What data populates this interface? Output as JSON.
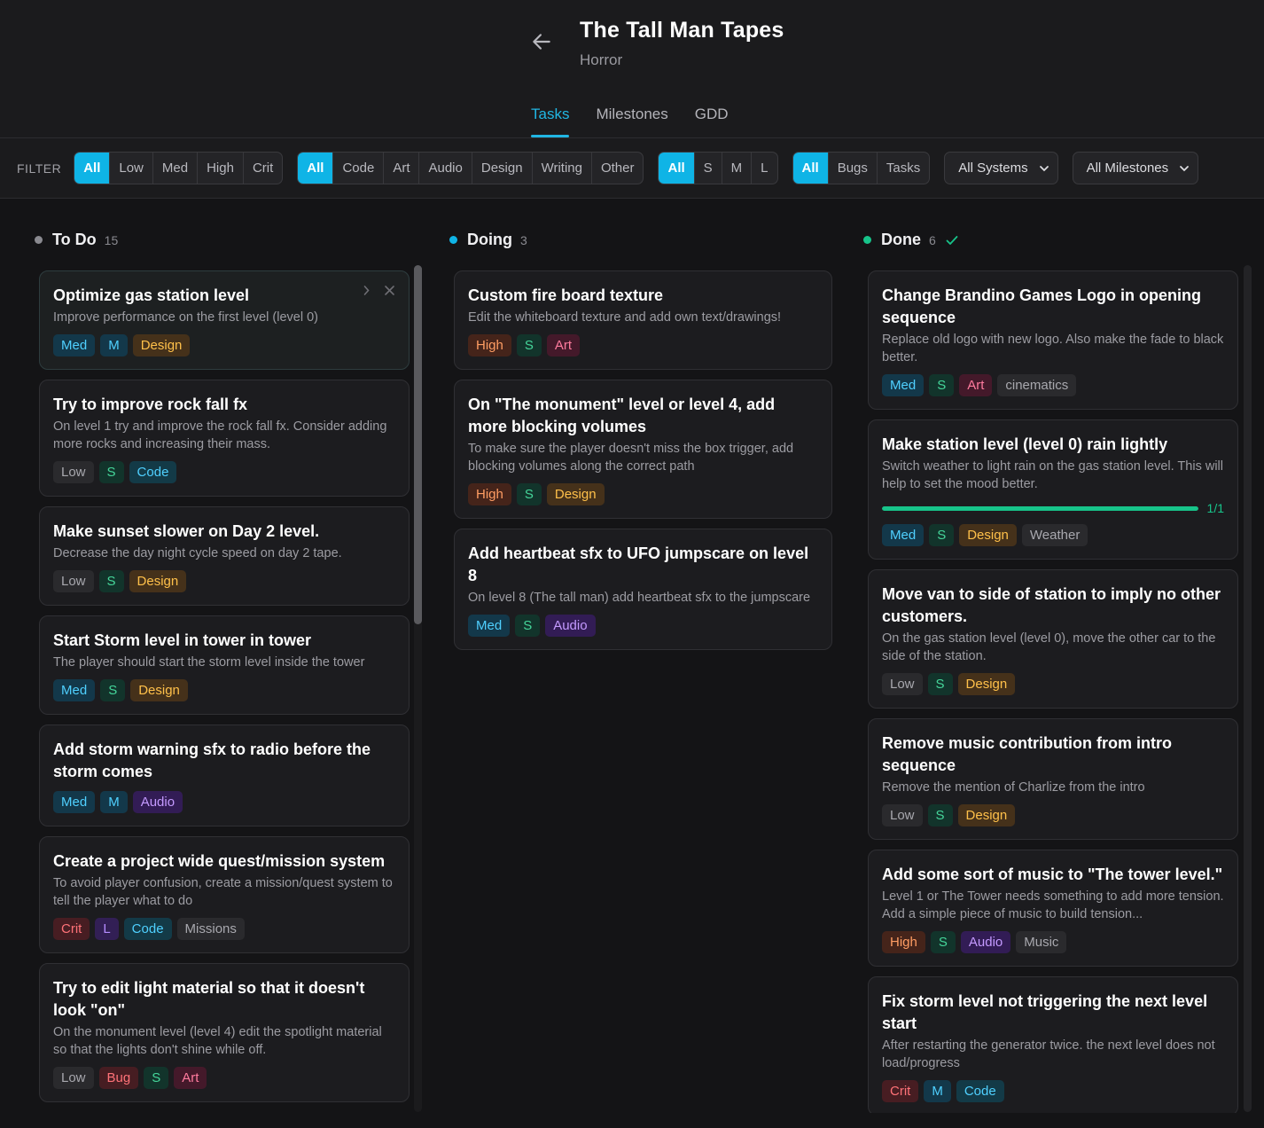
{
  "project": {
    "title": "The Tall Man Tapes",
    "genre": "Horror"
  },
  "tabs": [
    {
      "label": "Tasks",
      "active": true
    },
    {
      "label": "Milestones"
    },
    {
      "label": "GDD"
    }
  ],
  "filter": {
    "label": "FILTER",
    "priority": [
      "All",
      "Low",
      "Med",
      "High",
      "Crit"
    ],
    "discipline": [
      "All",
      "Code",
      "Art",
      "Audio",
      "Design",
      "Writing",
      "Other"
    ],
    "size": [
      "All",
      "S",
      "M",
      "L"
    ],
    "type": [
      "All",
      "Bugs",
      "Tasks"
    ],
    "systems": "All Systems",
    "milestones": "All Milestones"
  },
  "colors": {
    "accent": "#0fb4e6",
    "todo_dot": "#8a8a90",
    "doing_dot": "#0fb4e6",
    "done_dot": "#17c48a"
  },
  "columns": {
    "todo": {
      "title": "To Do",
      "count": "15",
      "cards": [
        {
          "title": "Optimize gas station level",
          "desc": "Improve performance on the first level (level 0)",
          "tags": [
            "Med",
            "M",
            "Design"
          ]
        },
        {
          "title": "Try to improve rock fall fx",
          "desc": "On level 1 try and improve the rock fall fx. Consider adding more rocks and increasing their mass.",
          "tags": [
            "Low",
            "S",
            "Code"
          ]
        },
        {
          "title": "Make sunset slower on Day 2 level.",
          "desc": "Decrease the day night cycle speed on day 2 tape.",
          "tags": [
            "Low",
            "S",
            "Design"
          ]
        },
        {
          "title": "Start Storm level in tower in tower",
          "desc": "The player should start the storm level inside the tower",
          "tags": [
            "Med",
            "S",
            "Design"
          ]
        },
        {
          "title": "Add storm warning sfx to radio before the storm comes",
          "desc": "",
          "tags": [
            "Med",
            "M",
            "Audio"
          ]
        },
        {
          "title": "Create a project wide quest/mission system",
          "desc": "To avoid player confusion, create a mission/quest system to tell the player what to do",
          "tags": [
            "Crit",
            "L",
            "Code",
            "Missions"
          ]
        },
        {
          "title": "Try to edit light material so that it doesn't look \"on\"",
          "desc": "On the monument level (level 4) edit the spotlight material so that the lights don't shine while off.",
          "tags": [
            "Low",
            "Bug",
            "S",
            "Art"
          ]
        }
      ]
    },
    "doing": {
      "title": "Doing",
      "count": "3",
      "cards": [
        {
          "title": "Custom fire board texture",
          "desc": "Edit the whiteboard texture and add own text/drawings!",
          "tags": [
            "High",
            "S",
            "Art"
          ]
        },
        {
          "title": "On \"The monument\" level or level 4, add more blocking volumes",
          "desc": "To make sure the player doesn't miss the box trigger, add blocking volumes along the correct path",
          "tags": [
            "High",
            "S",
            "Design"
          ]
        },
        {
          "title": "Add heartbeat sfx to UFO jumpscare on level 8",
          "desc": "On level 8 (The tall man) add heartbeat sfx to the jumpscare",
          "tags": [
            "Med",
            "S",
            "Audio"
          ]
        }
      ]
    },
    "done": {
      "title": "Done",
      "count": "6",
      "cards": [
        {
          "title": "Change Brandino Games Logo in opening sequence",
          "desc": "Replace old logo with new logo. Also make the fade to black better.",
          "tags": [
            "Med",
            "S",
            "Art",
            "cinematics"
          ]
        },
        {
          "title": "Make station level (level 0) rain lightly",
          "desc": "Switch weather to light rain on the gas station level. This will help to set the mood better.",
          "progress": {
            "value": 1.0,
            "label": "1/1"
          },
          "tags": [
            "Med",
            "S",
            "Design",
            "Weather"
          ]
        },
        {
          "title": "Move van to side of station to imply no other customers.",
          "desc": "On the gas station level (level 0), move the other car to the side of the station.",
          "tags": [
            "Low",
            "S",
            "Design"
          ]
        },
        {
          "title": "Remove music contribution from intro sequence",
          "desc": "Remove the mention of Charlize from the intro",
          "tags": [
            "Low",
            "S",
            "Design"
          ]
        },
        {
          "title": "Add some sort of music to \"The tower level.\"",
          "desc": "Level 1 or The Tower needs something to add more tension. Add a simple piece of music to build tension...",
          "tags": [
            "High",
            "S",
            "Audio",
            "Music"
          ]
        },
        {
          "title": "Fix storm level not triggering the next level start",
          "desc": "After restarting the generator twice. the next level does not load/progress",
          "tags": [
            "Crit",
            "M",
            "Code"
          ]
        }
      ]
    }
  }
}
